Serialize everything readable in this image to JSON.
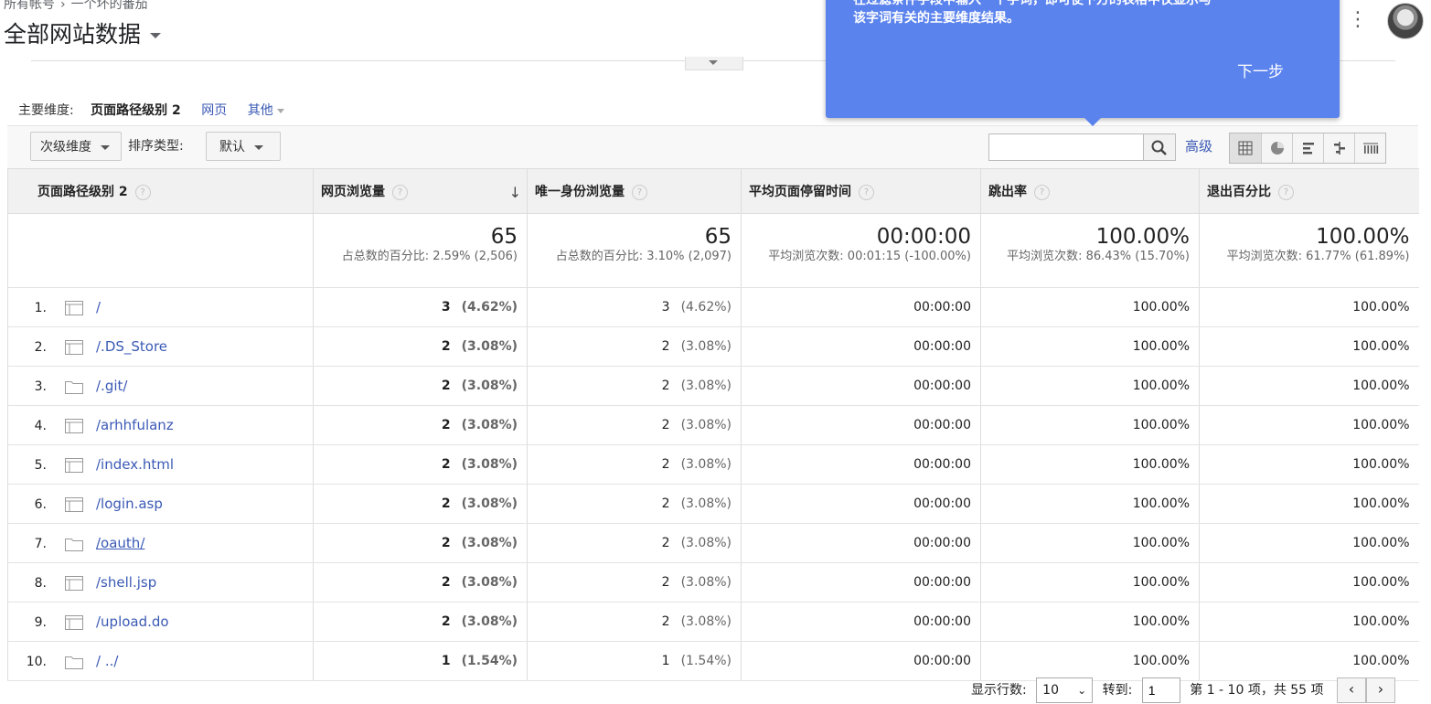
{
  "header": {
    "breadcrumb": [
      "所有帐号",
      "一个坏的番茄"
    ],
    "breadcrumb_sep": "›",
    "title": "全部网站数据"
  },
  "tooltip": {
    "text_line1": "在过滤条件字段中输入一个字词，即可使下方的表格中仅显示与",
    "text_line2_prefix": "该字词有关的",
    "text_line2_bold": "主要维度",
    "text_line2_suffix": "结果。",
    "next_label": "下一步"
  },
  "dimension_bar": {
    "label": "主要维度:",
    "selected": "页面路径级别 2",
    "link_page": "网页",
    "link_other": "其他"
  },
  "toolbar": {
    "secondary_dim_label": "次级维度",
    "sort_type_label": "排序类型:",
    "sort_default": "默认",
    "search_placeholder": "",
    "advanced_label": "高级",
    "view_icons": [
      "grid-view-icon",
      "pie-view-icon",
      "bar-view-icon",
      "comparison-view-icon",
      "pivot-view-icon"
    ]
  },
  "table": {
    "columns": [
      "页面路径级别 2",
      "网页浏览量",
      "唯一身份浏览量",
      "平均页面停留时间",
      "跳出率",
      "退出百分比"
    ],
    "totals": [
      {
        "value": "65",
        "sub": "占总数的百分比: 2.59% (2,506)"
      },
      {
        "value": "65",
        "sub": "占总数的百分比: 3.10% (2,097)"
      },
      {
        "value": "00:00:00",
        "sub": "平均浏览次数: 00:01:15 (-100.00%)"
      },
      {
        "value": "100.00%",
        "sub": "平均浏览次数: 86.43% (15.70%)"
      },
      {
        "value": "100.00%",
        "sub": "平均浏览次数: 61.77% (61.89%)"
      }
    ],
    "rows": [
      {
        "n": "1.",
        "icon": "page-icon",
        "path": "/",
        "pv": "3",
        "pv_pct": "(4.62%)",
        "upv": "3",
        "upv_pct": "(4.62%)",
        "time": "00:00:00",
        "bounce": "100.00%",
        "exit": "100.00%"
      },
      {
        "n": "2.",
        "icon": "page-icon",
        "path": "/.DS_Store",
        "pv": "2",
        "pv_pct": "(3.08%)",
        "upv": "2",
        "upv_pct": "(3.08%)",
        "time": "00:00:00",
        "bounce": "100.00%",
        "exit": "100.00%"
      },
      {
        "n": "3.",
        "icon": "folder-icon",
        "path": "/.git/",
        "pv": "2",
        "pv_pct": "(3.08%)",
        "upv": "2",
        "upv_pct": "(3.08%)",
        "time": "00:00:00",
        "bounce": "100.00%",
        "exit": "100.00%"
      },
      {
        "n": "4.",
        "icon": "page-icon",
        "path": "/arhhfulanz",
        "pv": "2",
        "pv_pct": "(3.08%)",
        "upv": "2",
        "upv_pct": "(3.08%)",
        "time": "00:00:00",
        "bounce": "100.00%",
        "exit": "100.00%"
      },
      {
        "n": "5.",
        "icon": "page-icon",
        "path": "/index.html",
        "pv": "2",
        "pv_pct": "(3.08%)",
        "upv": "2",
        "upv_pct": "(3.08%)",
        "time": "00:00:00",
        "bounce": "100.00%",
        "exit": "100.00%"
      },
      {
        "n": "6.",
        "icon": "page-icon",
        "path": "/login.asp",
        "pv": "2",
        "pv_pct": "(3.08%)",
        "upv": "2",
        "upv_pct": "(3.08%)",
        "time": "00:00:00",
        "bounce": "100.00%",
        "exit": "100.00%"
      },
      {
        "n": "7.",
        "icon": "folder-icon",
        "path": "/oauth/",
        "pv": "2",
        "pv_pct": "(3.08%)",
        "upv": "2",
        "upv_pct": "(3.08%)",
        "time": "00:00:00",
        "bounce": "100.00%",
        "exit": "100.00%"
      },
      {
        "n": "8.",
        "icon": "page-icon",
        "path": "/shell.jsp",
        "pv": "2",
        "pv_pct": "(3.08%)",
        "upv": "2",
        "upv_pct": "(3.08%)",
        "time": "00:00:00",
        "bounce": "100.00%",
        "exit": "100.00%"
      },
      {
        "n": "9.",
        "icon": "page-icon",
        "path": "/upload.do",
        "pv": "2",
        "pv_pct": "(3.08%)",
        "upv": "2",
        "upv_pct": "(3.08%)",
        "time": "00:00:00",
        "bounce": "100.00%",
        "exit": "100.00%"
      },
      {
        "n": "10.",
        "icon": "folder-icon",
        "path": "/ ../",
        "pv": "1",
        "pv_pct": "(1.54%)",
        "upv": "1",
        "upv_pct": "(1.54%)",
        "time": "00:00:00",
        "bounce": "100.00%",
        "exit": "100.00%"
      }
    ]
  },
  "pager": {
    "rows_label": "显示行数:",
    "rows_value": "10",
    "goto_label": "转到:",
    "goto_value": "1",
    "range_text": "第 1 - 10 项，共 55 项"
  },
  "colors": {
    "tooltip_bg": "#5b83ed",
    "link": "#3b5ab5"
  }
}
